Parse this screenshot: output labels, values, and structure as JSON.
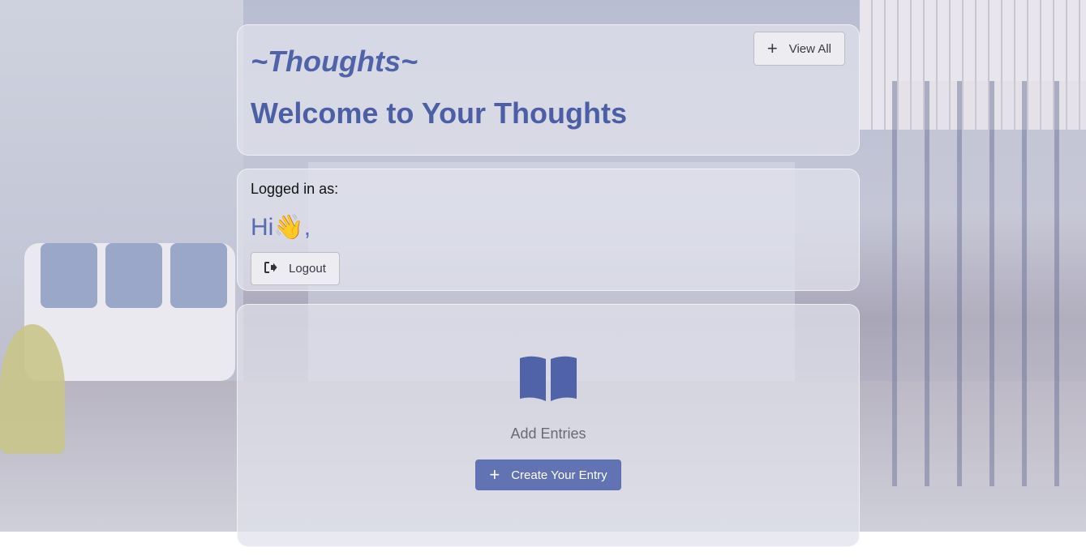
{
  "header": {
    "brand": "~Thoughts~",
    "welcome": "Welcome to Your Thoughts",
    "view_all_label": "View All",
    "view_all_icon": "plus-icon"
  },
  "user": {
    "logged_in_label": "Logged in as:",
    "greeting": "Hi",
    "greeting_emoji": "👋",
    "greeting_suffix": ",",
    "logout_label": "Logout",
    "logout_icon": "sign-out-icon"
  },
  "entries": {
    "icon": "book-open-icon",
    "label": "Add Entries",
    "create_label": "Create Your Entry",
    "create_icon": "plus-icon"
  },
  "colors": {
    "accent": "#5063a8",
    "button_primary": "#6273b4"
  }
}
